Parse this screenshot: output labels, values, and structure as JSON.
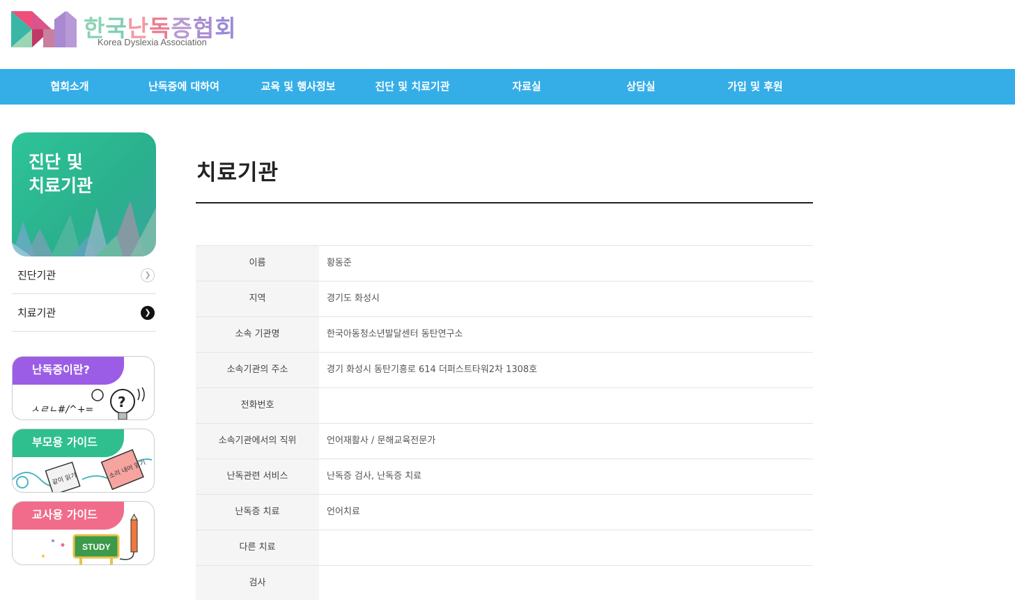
{
  "header": {
    "logo_title_chars": [
      "한",
      "국",
      "난",
      "독",
      "증",
      "협",
      "회"
    ],
    "logo_title_colors": [
      "#8bd3b5",
      "#7ecfb1",
      "#f29aa3",
      "#ea7c8f",
      "#b89ad0",
      "#a98dd2",
      "#9b8bd6"
    ],
    "logo_subtitle": "Korea Dyslexia Association"
  },
  "nav": {
    "items": [
      "협회소개",
      "난독증에 대하여",
      "교육 및 행사정보",
      "진단 및 치료기관",
      "자료실",
      "상담실",
      "가입 및 후원"
    ]
  },
  "sidebar": {
    "banner_title_line1": "진단 및",
    "banner_title_line2": "치료기관",
    "menu": [
      {
        "label": "진단기관",
        "active": false
      },
      {
        "label": "치료기관",
        "active": true
      }
    ],
    "guides": [
      {
        "label": "난독증이란?",
        "color": "#9b5de5"
      },
      {
        "label": "부모용 가이드",
        "color": "#2fbf8f"
      },
      {
        "label": "교사용 가이드",
        "color": "#f06c8a"
      }
    ],
    "study_text": "STUDY",
    "doodle_text": "ㅅㄹㄴ#/^+=",
    "box1_text": "같이 읽기",
    "box2_text": "소리 내어 읽기"
  },
  "main": {
    "title": "치료기관",
    "rows": [
      {
        "label": "이름",
        "value": "황동준"
      },
      {
        "label": "지역",
        "value": "경기도 화성시"
      },
      {
        "label": "소속 기관명",
        "value": "한국아동청소년발달센터 동탄연구소"
      },
      {
        "label": "소속기관의 주소",
        "value": "경기 화성시 동탄기흥로 614 더퍼스트타워2차 1308호"
      },
      {
        "label": "전화번호",
        "value": ""
      },
      {
        "label": "소속기관에서의 직위",
        "value": "언어재활사 / 문해교육전문가"
      },
      {
        "label": "난독관련 서비스",
        "value": "난독증 검사, 난독증 치료"
      },
      {
        "label": "난독증 치료",
        "value": "언어치료"
      },
      {
        "label": "다른 치료",
        "value": ""
      },
      {
        "label": "검사",
        "value": ""
      }
    ]
  },
  "colors": {
    "nav_bg": "#35aee8",
    "banner_green": "#2ec49a"
  }
}
